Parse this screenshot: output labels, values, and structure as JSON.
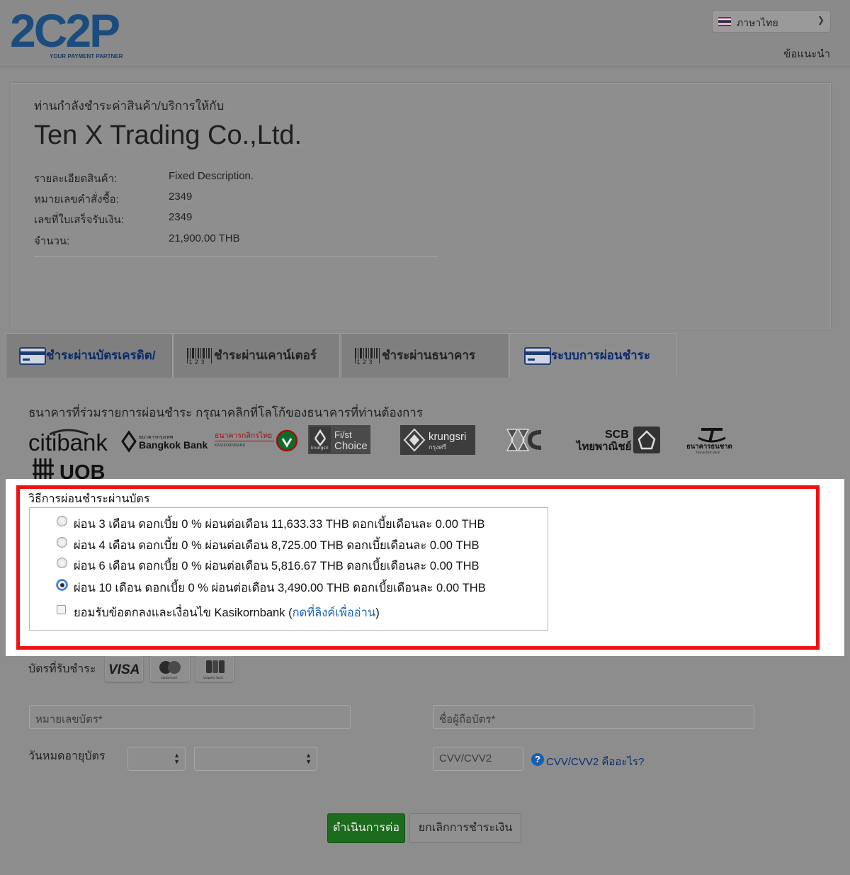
{
  "header": {
    "logo_text": "2C2P",
    "logo_tagline": "YOUR PAYMENT PARTNER",
    "language": "ภาษาไทย",
    "help_link": "ข้อแนะนำ"
  },
  "merchant": {
    "intro": "ท่านกำลังชำระค่าสินค้า/บริการให้กับ",
    "name": "Ten X Trading Co.,Ltd.",
    "details": [
      {
        "label": "รายละเอียดสินค้า:",
        "value": "Fixed Description."
      },
      {
        "label": "หมายเลขคำสั่งซื้อ:",
        "value": "2349"
      },
      {
        "label": "เลขที่ใบเสร็จรับเงิน:",
        "value": "2349"
      },
      {
        "label": "จำนวน:",
        "value": "21,900.00 THB"
      }
    ]
  },
  "tabs": [
    {
      "label": "ชำระผ่านบัตรเครดิต/",
      "icon": "credit-card-icon",
      "active": false
    },
    {
      "label": "ชำระผ่านเคาน์เตอร์",
      "icon": "barcode-icon",
      "active": false
    },
    {
      "label": "ชำระผ่านธนาคาร",
      "icon": "barcode-icon",
      "active": false
    },
    {
      "label": "ระบบการผ่อนชำระ",
      "icon": "credit-card-icon",
      "active": true
    }
  ],
  "installment": {
    "bank_instruction": "ธนาคารที่ร่วมรายการผ่อนชำระ กรุณาคลิกที่โลโก้ของธนาคารที่ท่านต้องการ",
    "banks": {
      "citibank": "citibank",
      "bangkok_th": "ธนาคารกรุงเทพ",
      "bangkok": "Bangkok Bank",
      "kasikorn_th": "ธนาคารกสิกรไทย",
      "kasikorn": "KASIKORNBANK",
      "firstchoice_a": "Fi/st",
      "firstchoice_b": "Choice",
      "firstchoice_small": "krungsri",
      "krungsri": "krungsri",
      "krungsri_th": "กรุงศรี",
      "scb_a": "SCB",
      "scb_b": "ไทยพาณิชย์",
      "thanachart": "ธนาคารธนชาต",
      "thanachart_small": "Thanachart Bank",
      "uob": "UOB"
    },
    "options_title": "วิธีการผ่อนชำระผ่านบัตร",
    "options": [
      {
        "label": "ผ่อน 3 เดือน ดอกเบี้ย 0 % ผ่อนต่อเดือน 11,633.33 THB ดอกเบี้ยเดือนละ 0.00 THB",
        "selected": false
      },
      {
        "label": "ผ่อน 4 เดือน ดอกเบี้ย 0 % ผ่อนต่อเดือน 8,725.00 THB ดอกเบี้ยเดือนละ 0.00 THB",
        "selected": false
      },
      {
        "label": "ผ่อน 6 เดือน ดอกเบี้ย 0 % ผ่อนต่อเดือน 5,816.67 THB ดอกเบี้ยเดือนละ 0.00 THB",
        "selected": false
      },
      {
        "label": "ผ่อน 10 เดือน ดอกเบี้ย 0 % ผ่อนต่อเดือน 3,490.00 THB ดอกเบี้ยเดือนละ 0.00 THB",
        "selected": true
      }
    ],
    "terms_prefix": "ยอมรับข้อตกลงและเงื่อนไข Kasikornbank (",
    "terms_link": "กดที่ลิงค์เพื่ออ่าน",
    "terms_suffix": ")",
    "terms_checked": false
  },
  "card_form": {
    "accepted_label": "บัตรที่รับชำระ",
    "cards": [
      "VISA",
      "mastercard",
      "Unquely Yours"
    ],
    "card_number_placeholder": "หมายเลขบัตร*",
    "card_holder_placeholder": "ชื่อผู้ถือบัตร*",
    "expiry_label": "วันหมดอายุบัตร",
    "expiry_month": "",
    "expiry_year": "",
    "cvv_placeholder": "CVV/CVV2",
    "cvv_help": "CVV/CVV2 คืออะไร?",
    "cvv_help_icon": "?"
  },
  "buttons": {
    "continue": "ดำเนินการต่อ",
    "cancel": "ยกเลิกการชำระเงิน"
  },
  "colors": {
    "highlight_border": "#ee1111",
    "continue_button": "#1d6b1d",
    "link": "#1a66b3",
    "logo_blue": "#1b4c7e",
    "logo_teal": "#1d8a9e"
  }
}
